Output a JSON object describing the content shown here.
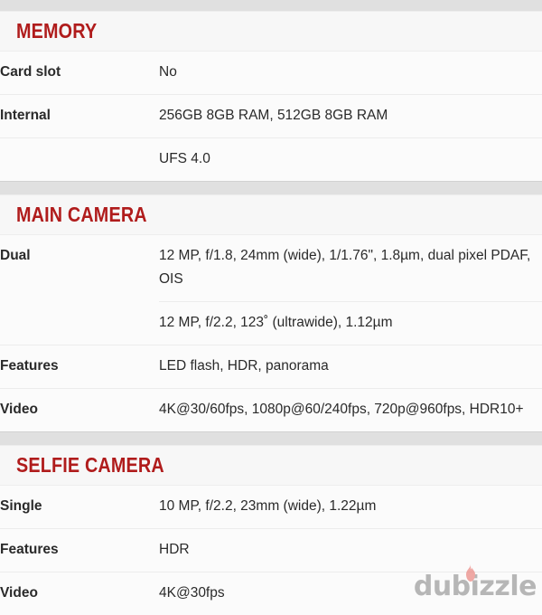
{
  "page": {
    "accent_color": "#b01c1c",
    "label_color": "#5a5a5a",
    "value_color": "#222222",
    "band_color": "#e0e0e0",
    "background": "#fbfbfb"
  },
  "sections": [
    {
      "id": "memory",
      "title": "MEMORY",
      "rows": [
        {
          "label": "Card slot",
          "value": "No"
        },
        {
          "label": "Internal",
          "value": "256GB 8GB RAM, 512GB 8GB RAM"
        },
        {
          "label": "",
          "value": "UFS 4.0"
        }
      ]
    },
    {
      "id": "main-camera",
      "title": "MAIN CAMERA",
      "rows": [
        {
          "label": "Dual",
          "value": "12 MP, f/1.8, 24mm (wide), 1/1.76\", 1.8µm, dual pixel PDAF, OIS"
        },
        {
          "label": "",
          "value": "12 MP, f/2.2, 123˚ (ultrawide), 1.12µm"
        },
        {
          "label": "Features",
          "value": "LED flash, HDR, panorama"
        },
        {
          "label": "Video",
          "value": "4K@30/60fps, 1080p@60/240fps, 720p@960fps, HDR10+"
        }
      ]
    },
    {
      "id": "selfie-camera",
      "title": "SELFIE CAMERA",
      "rows": [
        {
          "label": "Single",
          "value": "10 MP, f/2.2, 23mm (wide), 1.22µm"
        },
        {
          "label": "Features",
          "value": "HDR"
        },
        {
          "label": "Video",
          "value": "4K@30fps"
        }
      ]
    }
  ],
  "watermark": {
    "text": "dubizzle",
    "icon": "flame-icon",
    "flame_color": "#e8766f"
  }
}
